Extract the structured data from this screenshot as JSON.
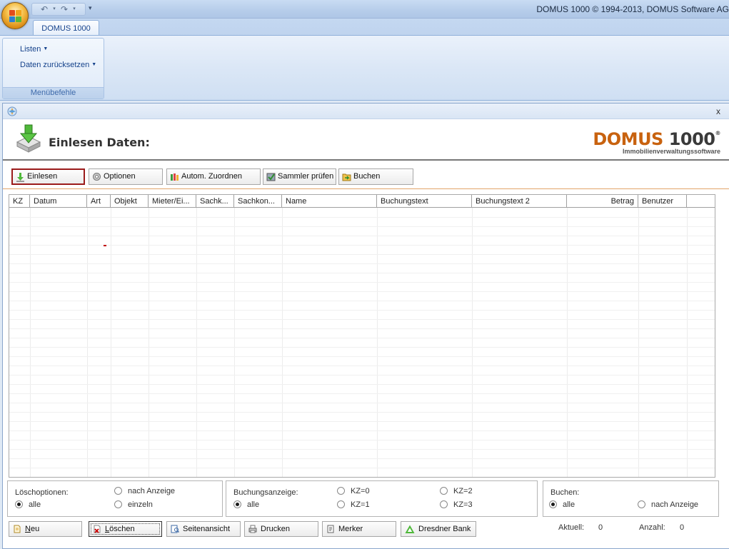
{
  "window": {
    "title": "DOMUS 1000 © 1994-2013, DOMUS Software AG"
  },
  "ribbon": {
    "tab": "DOMUS 1000",
    "items": [
      {
        "label": "Listen"
      },
      {
        "label": "Daten zurücksetzen"
      }
    ],
    "group_label": "Menübefehle"
  },
  "child": {
    "close_label": "x",
    "page_title": "Einlesen Daten:",
    "brand": {
      "name_part1": "DOMUS",
      "name_part2": " 1000",
      "reg": "®",
      "subtitle": "Immobilienverwaltungssoftware"
    }
  },
  "toolbar": {
    "buttons": [
      {
        "label": "Einlesen",
        "icon": "download-arrow-icon",
        "active": true
      },
      {
        "label": "Optionen",
        "icon": "gear-icon"
      },
      {
        "label": "Autom. Zuordnen",
        "icon": "bottles-icon"
      },
      {
        "label": "Sammler prüfen",
        "icon": "box-check-icon"
      },
      {
        "label": "Buchen",
        "icon": "folder-arrow-icon"
      }
    ]
  },
  "grid": {
    "columns": [
      "KZ",
      "Datum",
      "Art",
      "Objekt",
      "Mieter/Ei...",
      "Sachk...",
      "Sachkon...",
      "Name",
      "Buchungstext",
      "Buchungstext 2",
      "Betrag",
      "Benutzer"
    ],
    "rows": []
  },
  "loeschoptionen": {
    "title": "Löschoptionen:",
    "options": [
      {
        "label": "nach Anzeige",
        "checked": false
      },
      {
        "label": "alle",
        "checked": true
      },
      {
        "label": "einzeln",
        "checked": false
      }
    ]
  },
  "buchungsanzeige": {
    "title": "Buchungsanzeige:",
    "options": [
      {
        "label": "alle",
        "checked": true
      },
      {
        "label": "KZ=0",
        "checked": false
      },
      {
        "label": "KZ=1",
        "checked": false
      },
      {
        "label": "KZ=2",
        "checked": false
      },
      {
        "label": "KZ=3",
        "checked": false
      }
    ]
  },
  "buchen": {
    "title": "Buchen:",
    "options": [
      {
        "label": "alle",
        "checked": true
      },
      {
        "label": "nach Anzeige",
        "checked": false
      }
    ]
  },
  "bottom_buttons": [
    {
      "label": "Neu",
      "underline": "N",
      "rest": "eu",
      "icon": "new-document-icon"
    },
    {
      "label": "Löschen",
      "underline": "L",
      "rest": "öschen",
      "icon": "delete-document-icon",
      "focused": true
    },
    {
      "label": "Seitenansicht",
      "icon": "page-preview-icon"
    },
    {
      "label": "Drucken",
      "icon": "printer-icon"
    },
    {
      "label": "Merker",
      "icon": "notepad-icon"
    },
    {
      "label": "Dresdner Bank",
      "icon": "dresdner-bank-logo-icon"
    }
  ],
  "status": {
    "aktuell_label": "Aktuell:",
    "aktuell_value": "0",
    "anzahl_label": "Anzahl:",
    "anzahl_value": "0"
  },
  "colors": {
    "accent_orange": "#c8620f",
    "active_border": "#9b1b1b",
    "ribbon_text": "#15428b"
  }
}
